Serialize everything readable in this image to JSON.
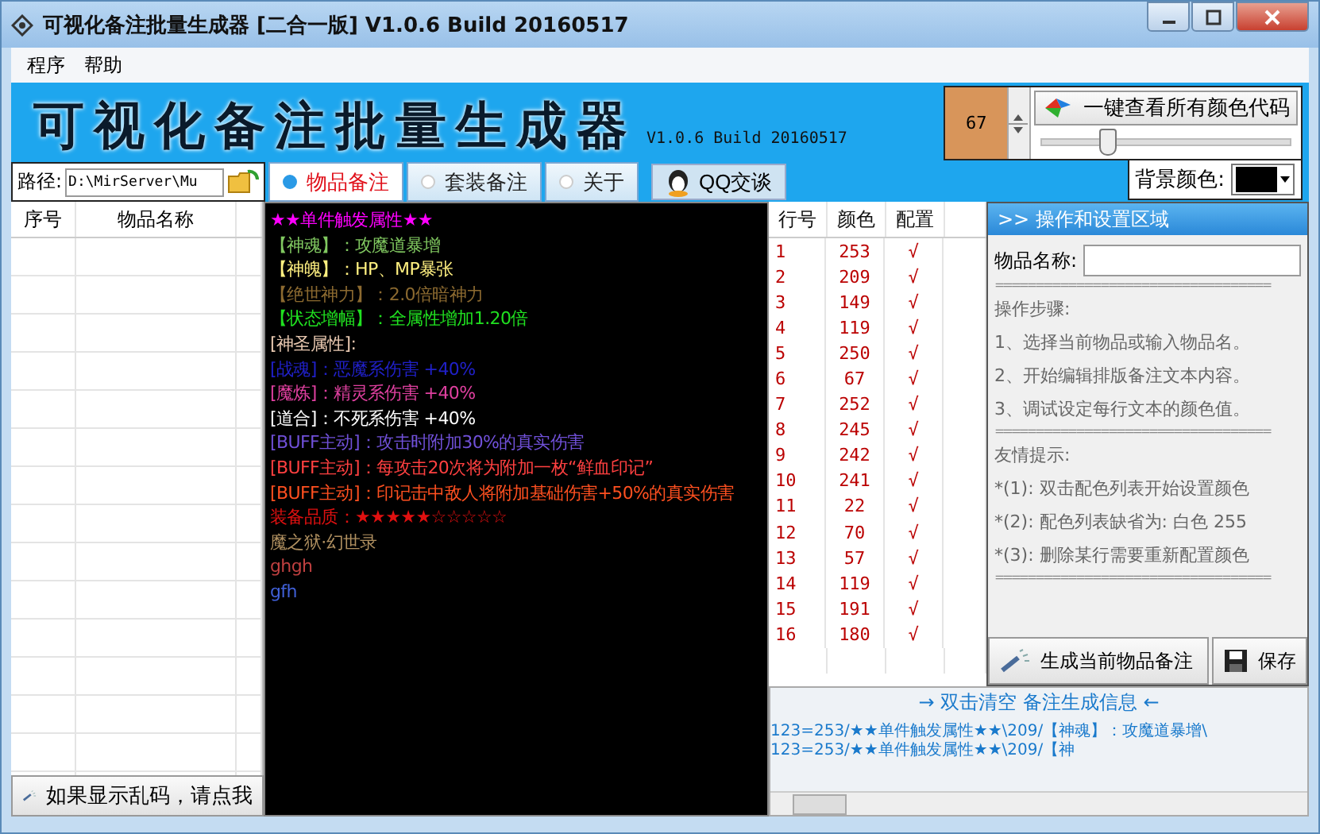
{
  "window": {
    "title": "可视化备注批量生成器 [二合一版] V1.0.6 Build 20160517"
  },
  "menu": [
    "程序",
    "帮助"
  ],
  "banner": {
    "title": "可视化备注批量生成器",
    "version": "V1.0.6 Build 20160517"
  },
  "color_picker": {
    "value": "67",
    "button": "一键查看所有颜色代码",
    "level": 0.27,
    "background_label": "背景颜色:"
  },
  "path": {
    "label": "路径:",
    "value": "D:\\MirServer\\Mu"
  },
  "tabs": [
    {
      "label": "物品备注",
      "selected": true
    },
    {
      "label": "套装备注",
      "selected": false
    },
    {
      "label": "关于",
      "selected": false
    }
  ],
  "qq_button": "QQ交谈",
  "item_table": {
    "columns": [
      "序号",
      "物品名称"
    ]
  },
  "garbled_button": "如果显示乱码，请点我",
  "editor_lines": [
    {
      "text": "★★单件触发属性★★",
      "color": "#ff00ff"
    },
    {
      "text": "【神魂】：攻魔道暴增",
      "color": "#80c860"
    },
    {
      "text": "【神魄】：HP、MP暴张",
      "color": "#fff080"
    },
    {
      "text": "【绝世神力】：2.0倍暗神力",
      "color": "#8c6a30"
    },
    {
      "text": "【状态增幅】：全属性增加1.20倍",
      "color": "#20e020"
    },
    {
      "text": "[神圣属性]:",
      "color": "#e8c8b0"
    },
    {
      "text": "[战魂]：恶魔系伤害 +40%",
      "color": "#2020c8"
    },
    {
      "text": "[魔炼]：精灵系伤害 +40%",
      "color": "#e040a0"
    },
    {
      "text": "[道合]：不死系伤害 +40%",
      "color": "#ffffff"
    },
    {
      "text": "[BUFF主动]：攻击时附加30%的真实伤害",
      "color": "#7050d8"
    },
    {
      "text": "[BUFF主动]：每攻击20次将为附加一枚“鲜血印记”",
      "color": "#ff4040"
    },
    {
      "text": "[BUFF主动]：印记击中敌人将附加基础伤害+50%的真实伤害",
      "color": "#ff5020"
    },
    {
      "text": "装备品质：★★★★★☆☆☆☆☆",
      "color": "#e01010"
    },
    {
      "text": "魔之狱·幻世录",
      "color": "#b09060"
    },
    {
      "text": "ghgh",
      "color": "#c04040"
    },
    {
      "text": "gfh",
      "color": "#4060d8"
    }
  ],
  "config_table": {
    "columns": [
      "行号",
      "颜色",
      "配置"
    ],
    "rows": [
      [
        "1",
        "253",
        "√"
      ],
      [
        "2",
        "209",
        "√"
      ],
      [
        "3",
        "149",
        "√"
      ],
      [
        "4",
        "119",
        "√"
      ],
      [
        "5",
        "250",
        "√"
      ],
      [
        "6",
        "67",
        "√"
      ],
      [
        "7",
        "252",
        "√"
      ],
      [
        "8",
        "245",
        "√"
      ],
      [
        "9",
        "242",
        "√"
      ],
      [
        "10",
        "241",
        "√"
      ],
      [
        "11",
        "22",
        "√"
      ],
      [
        "12",
        "70",
        "√"
      ],
      [
        "13",
        "57",
        "√"
      ],
      [
        "14",
        "119",
        "√"
      ],
      [
        "15",
        "191",
        "√"
      ],
      [
        "16",
        "180",
        "√"
      ]
    ]
  },
  "settings_panel": {
    "header": ">> 操作和设置区域",
    "name_label": "物品名称:",
    "lines": [
      {
        "kind": "rule",
        "text": "=================================="
      },
      {
        "kind": "text",
        "text": "操作步骤:"
      },
      {
        "kind": "text",
        "text": "1、选择当前物品或输入物品名。"
      },
      {
        "kind": "text",
        "text": "2、开始编辑排版备注文本内容。"
      },
      {
        "kind": "text",
        "text": "3、调试设定每行文本的颜色值。"
      },
      {
        "kind": "rule",
        "text": "=================================="
      },
      {
        "kind": "text",
        "text": "友情提示:"
      },
      {
        "kind": "text",
        "text": "*(1): 双击配色列表开始设置颜色"
      },
      {
        "kind": "text",
        "text": "*(2): 配色列表缺省为: 白色 255"
      },
      {
        "kind": "text",
        "text": "*(3): 删除某行需要重新配置颜色"
      },
      {
        "kind": "rule",
        "text": "=================================="
      }
    ],
    "generate_button": "生成当前物品备注",
    "save_button": "保存"
  },
  "log": {
    "header": "→ 双击清空 备注生成信息 ←",
    "lines": [
      "123=253/★★单件触发属性★★\\209/【神魂】：攻魔道暴增\\",
      "123=253/★★单件触发属性★★\\209/【神"
    ]
  }
}
